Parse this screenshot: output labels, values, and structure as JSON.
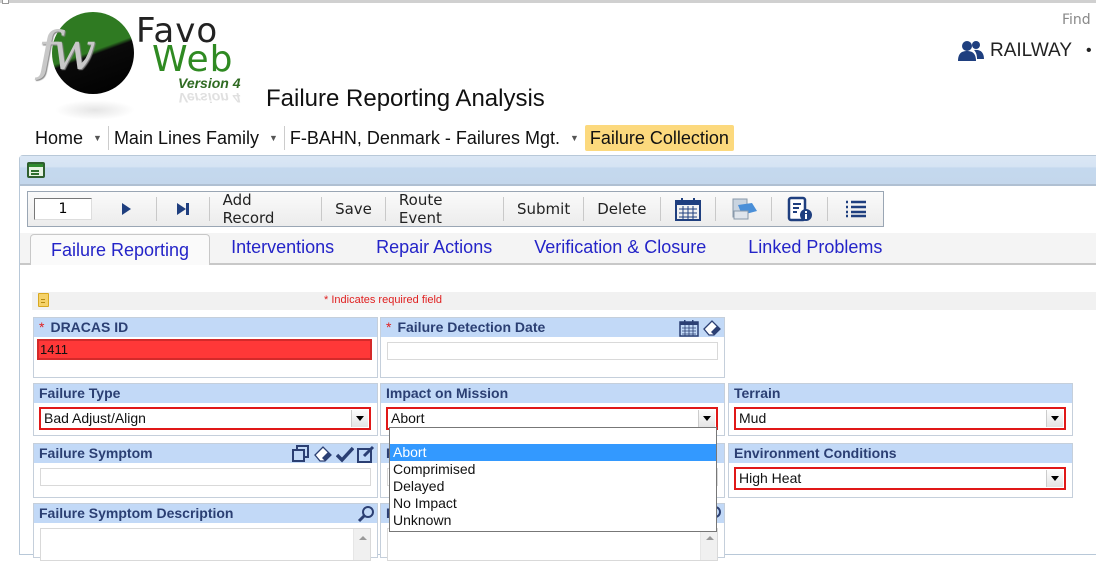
{
  "app": {
    "logo": {
      "monogram": "fw",
      "name_line1": "Favo",
      "name_line2": "Web",
      "version": "Version 4"
    },
    "page_title": "Failure Reporting Analysis",
    "find_label": "Find",
    "user": {
      "icon": "users-icon",
      "name": "RAILWAY",
      "more": "•"
    }
  },
  "breadcrumb": [
    {
      "label": "Home",
      "has_menu": true
    },
    {
      "label": "Main Lines Family",
      "has_menu": true
    },
    {
      "label": "F-BAHN, Denmark - Failures Mgt.",
      "has_menu": true
    },
    {
      "label": "Failure Collection",
      "has_menu": false,
      "active": true
    }
  ],
  "toolbar": {
    "record_number": "1",
    "next_icon": "play-next-icon",
    "last_icon": "skip-last-icon",
    "buttons": [
      "Add Record",
      "Save",
      "Route Event",
      "Submit",
      "Delete"
    ],
    "icons": [
      "calendar-icon",
      "print-icon",
      "document-info-icon",
      "list-icon"
    ]
  },
  "tabs": [
    {
      "label": "Failure Reporting",
      "active": true
    },
    {
      "label": "Interventions"
    },
    {
      "label": "Repair Actions"
    },
    {
      "label": "Verification & Closure"
    },
    {
      "label": "Linked Problems"
    }
  ],
  "required_note": "*  Indicates required field",
  "fields": {
    "dracas_id": {
      "label": "DRACAS ID",
      "required": true,
      "value": "1411"
    },
    "failure_detection_date": {
      "label": "Failure Detection Date",
      "required": true,
      "value": ""
    },
    "failure_type": {
      "label": "Failure Type",
      "value": "Bad Adjust/Align"
    },
    "impact_on_mission": {
      "label": "Impact on Mission",
      "value": "Abort",
      "options": [
        "Abort",
        "Comprimised",
        "Delayed",
        "No Impact",
        "Unknown"
      ],
      "open": true
    },
    "terrain": {
      "label": "Terrain",
      "value": "Mud"
    },
    "failure_symptom": {
      "label": "Failure Symptom",
      "value": ""
    },
    "environment_conditions": {
      "label": "Environment Conditions",
      "value": "High Heat"
    },
    "failure_symptom_description": {
      "label": "Failure Symptom Description",
      "value": ""
    },
    "hidden_col2_row4_initial": "F",
    "hidden_col2_row5_initial": "F"
  },
  "colors": {
    "header_bg": "#c2d9f7",
    "header_text": "#2b3f73",
    "tab_link": "#2424c8",
    "required": "#e02020",
    "invalid_id_bg": "#ff3838",
    "breadcrumb_active": "#fcd97d",
    "dropdown_highlight": "#3399ff"
  }
}
